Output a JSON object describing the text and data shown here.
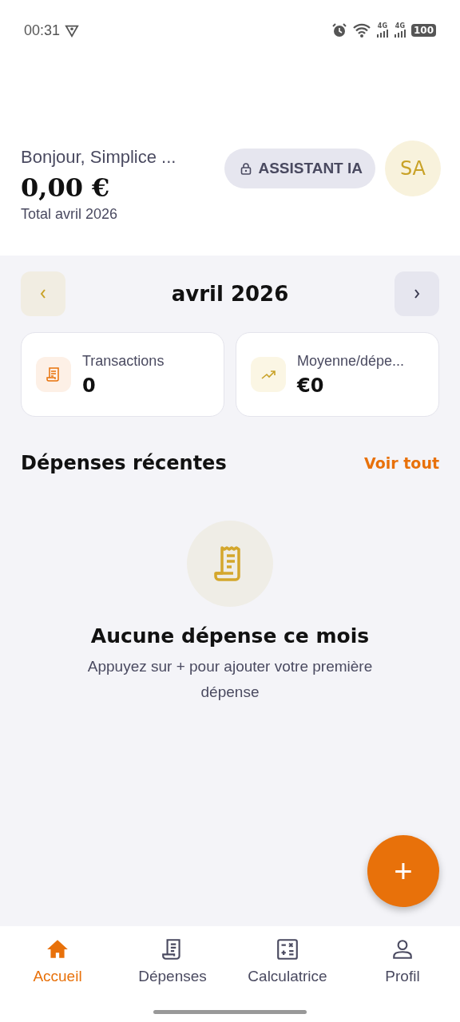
{
  "status_bar": {
    "time": "00:31",
    "network_1": "4G",
    "network_2": "4G",
    "battery": "100"
  },
  "header": {
    "greeting": "Bonjour, Simplice ...",
    "total": "0,00 €",
    "caption": "Total avril 2026",
    "assistant_button": "ASSISTANT IA",
    "assistant_locked": true,
    "avatar": "SA"
  },
  "month_nav": {
    "label": "avril 2026"
  },
  "stats": [
    {
      "kind": "receipt",
      "label": "Transactions",
      "value": "0"
    },
    {
      "kind": "trend",
      "label": "Moyenne/dépe...",
      "value": "€0"
    }
  ],
  "recent": {
    "title": "Dépenses récentes",
    "link": "Voir tout"
  },
  "empty_state": {
    "title": "Aucune dépense ce mois",
    "message": "Appuyez sur + pour ajouter votre première dépense"
  },
  "fab": "+",
  "bottom_nav": [
    {
      "kind": "home",
      "label": "Accueil",
      "selected": true
    },
    {
      "kind": "receipt",
      "label": "Dépenses",
      "selected": false
    },
    {
      "kind": "calculator",
      "label": "Calculatrice",
      "selected": false
    },
    {
      "kind": "profile",
      "label": "Profil",
      "selected": false
    }
  ]
}
